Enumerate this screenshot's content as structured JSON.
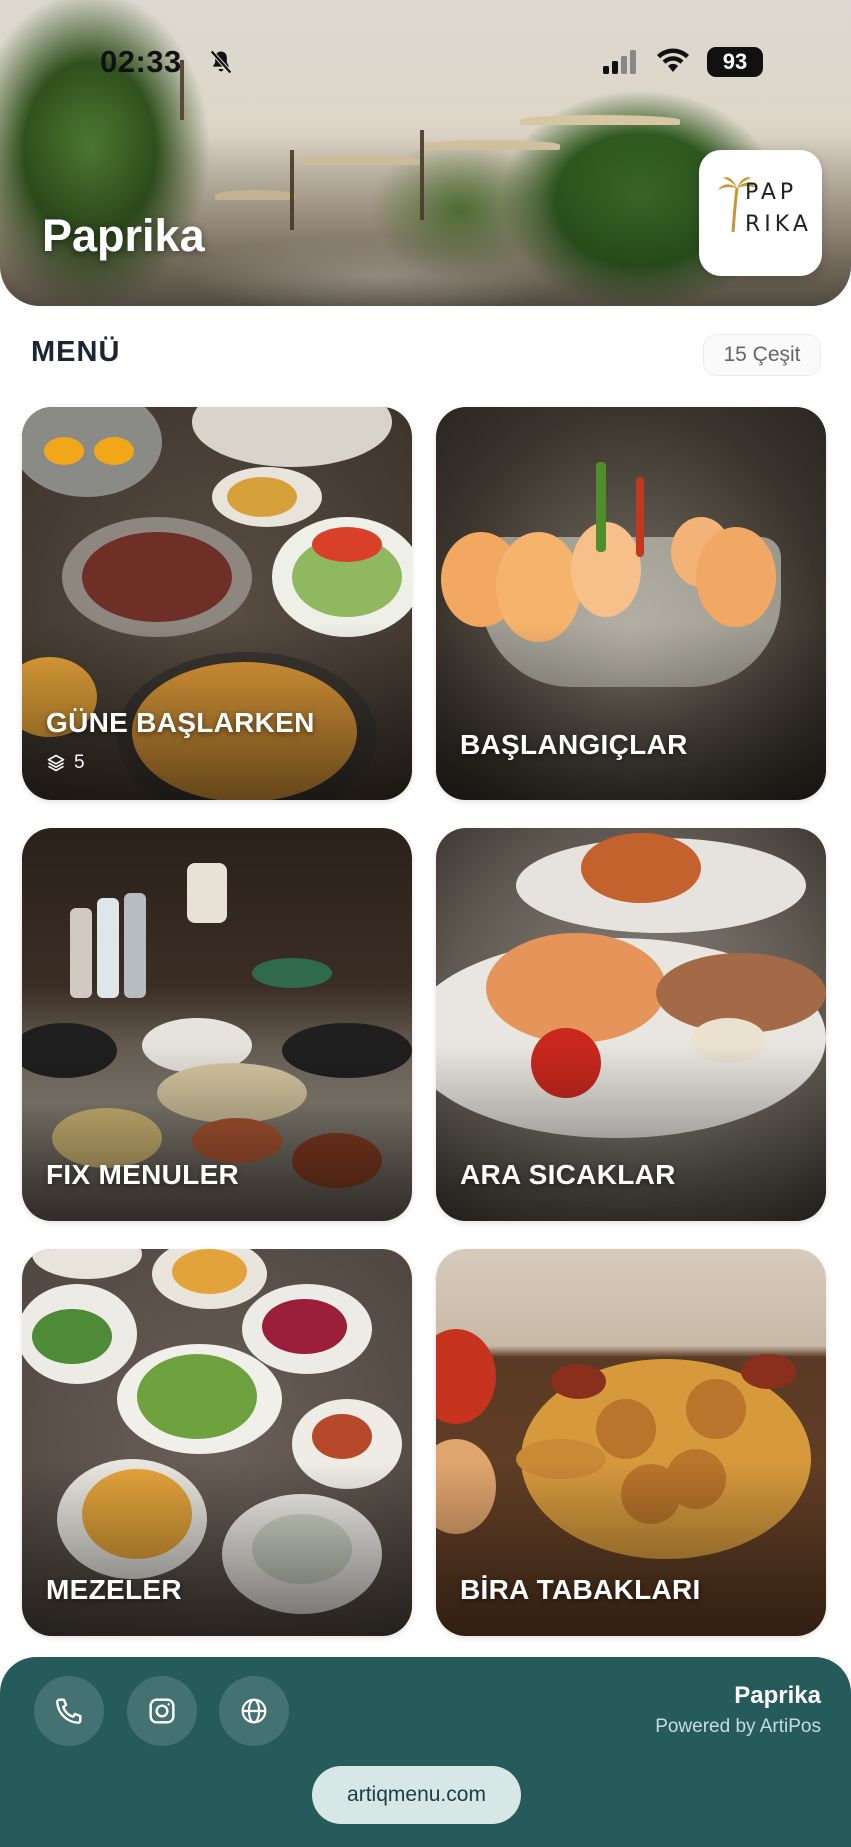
{
  "status_bar": {
    "time": "02:33",
    "battery": "93",
    "icons": [
      "bell-muted-icon",
      "signal-icon",
      "wifi-icon"
    ]
  },
  "hero": {
    "title": "Paprika",
    "logo_line_1": "PAP",
    "logo_line_2": "RIKA"
  },
  "menu": {
    "title": "MENÜ",
    "count_label": "15 Çeşit"
  },
  "categories": [
    {
      "label": "GÜNE BAŞLARKEN",
      "sub_count": "5"
    },
    {
      "label": "BAŞLANGIÇLAR"
    },
    {
      "label": "FIX MENULER"
    },
    {
      "label": "ARA SICAKLAR"
    },
    {
      "label": "MEZELER"
    },
    {
      "label": "BİRA TABAKLARI"
    }
  ],
  "footer": {
    "brand": "Paprika",
    "powered_by": "Powered by ArtiPos",
    "domain": "artiqmenu.com",
    "icons": [
      "phone-icon",
      "instagram-icon",
      "globe-icon"
    ],
    "background_color": "#265b5c"
  }
}
